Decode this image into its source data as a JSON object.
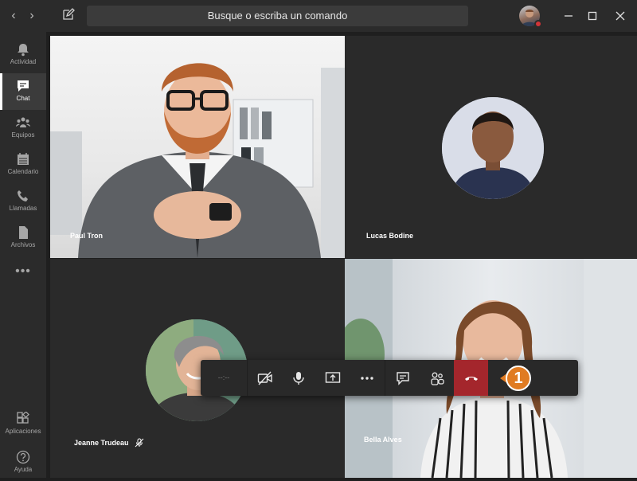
{
  "search": {
    "placeholder": "Busque o escriba un comando"
  },
  "rail": {
    "items": [
      {
        "label": "Actividad",
        "icon": "bell-icon"
      },
      {
        "label": "Chat",
        "icon": "chat-icon"
      },
      {
        "label": "Equipos",
        "icon": "teams-icon"
      },
      {
        "label": "Calendario",
        "icon": "calendar-icon"
      },
      {
        "label": "Llamadas",
        "icon": "phone-icon"
      },
      {
        "label": "Archivos",
        "icon": "file-icon"
      }
    ],
    "more": "•••",
    "bottom": [
      {
        "label": "Aplicaciones",
        "icon": "apps-icon"
      },
      {
        "label": "Ayuda",
        "icon": "help-icon"
      }
    ]
  },
  "participants": [
    {
      "name": "Paul Tron"
    },
    {
      "name": "Lucas Bodine"
    },
    {
      "name": "Jeanne Trudeau",
      "muted": true
    },
    {
      "name": "Bella Alves"
    }
  ],
  "toolbar": {
    "timer": "--:--"
  },
  "callout": {
    "number": "1"
  },
  "colors": {
    "hangup": "#a4262c",
    "callout": "#e07b22",
    "status_busy": "#d13438"
  }
}
